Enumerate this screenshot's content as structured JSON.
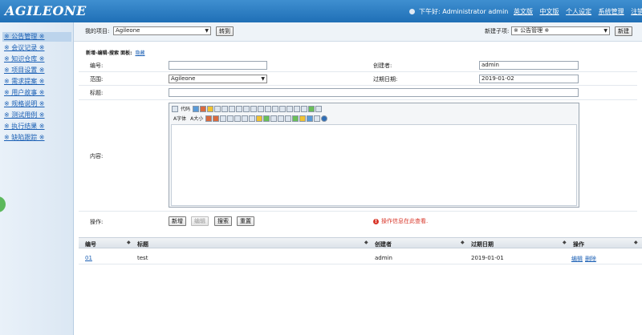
{
  "header": {
    "logo": "AGILEONE",
    "greeting": "下午好: Administrator admin",
    "links": [
      "英文版",
      "中文版",
      "个人设定",
      "系统管理",
      "注销"
    ]
  },
  "sidebar": {
    "items": [
      {
        "label": "※ 公告管理 ※",
        "active": true
      },
      {
        "label": "※ 会议记录 ※"
      },
      {
        "label": "※ 知识仓库 ※"
      },
      {
        "label": "※ 项目设置 ※"
      },
      {
        "label": "※ 需求提案 ※"
      },
      {
        "label": "※ 用户故事 ※"
      },
      {
        "label": "※ 规格说明 ※"
      },
      {
        "label": "※ 测试用例 ※"
      },
      {
        "label": "※ 执行结果 ※"
      },
      {
        "label": "※ 缺陷跟踪 ※"
      }
    ]
  },
  "project_bar": {
    "project_label": "我的项目:",
    "project_value": "Agileone",
    "goto_button": "转到",
    "subitem_label": "新建子项:",
    "subitem_value": "※ 公告管理 ※",
    "new_button": "新建"
  },
  "form": {
    "section_title": "新增-编辑-搜索 面板:",
    "hide_link": "隐藏",
    "id_label": "编号:",
    "id_value": "",
    "creator_label": "创建者:",
    "creator_value": "admin",
    "scope_label": "范围:",
    "scope_value": "Agileone",
    "expire_label": "过期日期:",
    "expire_value": "2019-01-02",
    "title_label": "标题:",
    "title_value": "",
    "content_label": "内容:",
    "editor_code": "代码",
    "editor_font": "字体",
    "editor_size": "大小",
    "action_label": "操作:",
    "buttons": {
      "add": "新增",
      "edit": "编辑",
      "search": "搜索",
      "reset": "重置"
    },
    "message": "操作信息在此查看."
  },
  "table": {
    "headers": [
      "编号",
      "标题",
      "创建者",
      "过期日期",
      "操作"
    ],
    "rows": [
      {
        "id": "01",
        "title": "test",
        "creator": "admin",
        "expire": "2019-01-01",
        "edit": "编辑",
        "delete": "删除"
      }
    ]
  }
}
